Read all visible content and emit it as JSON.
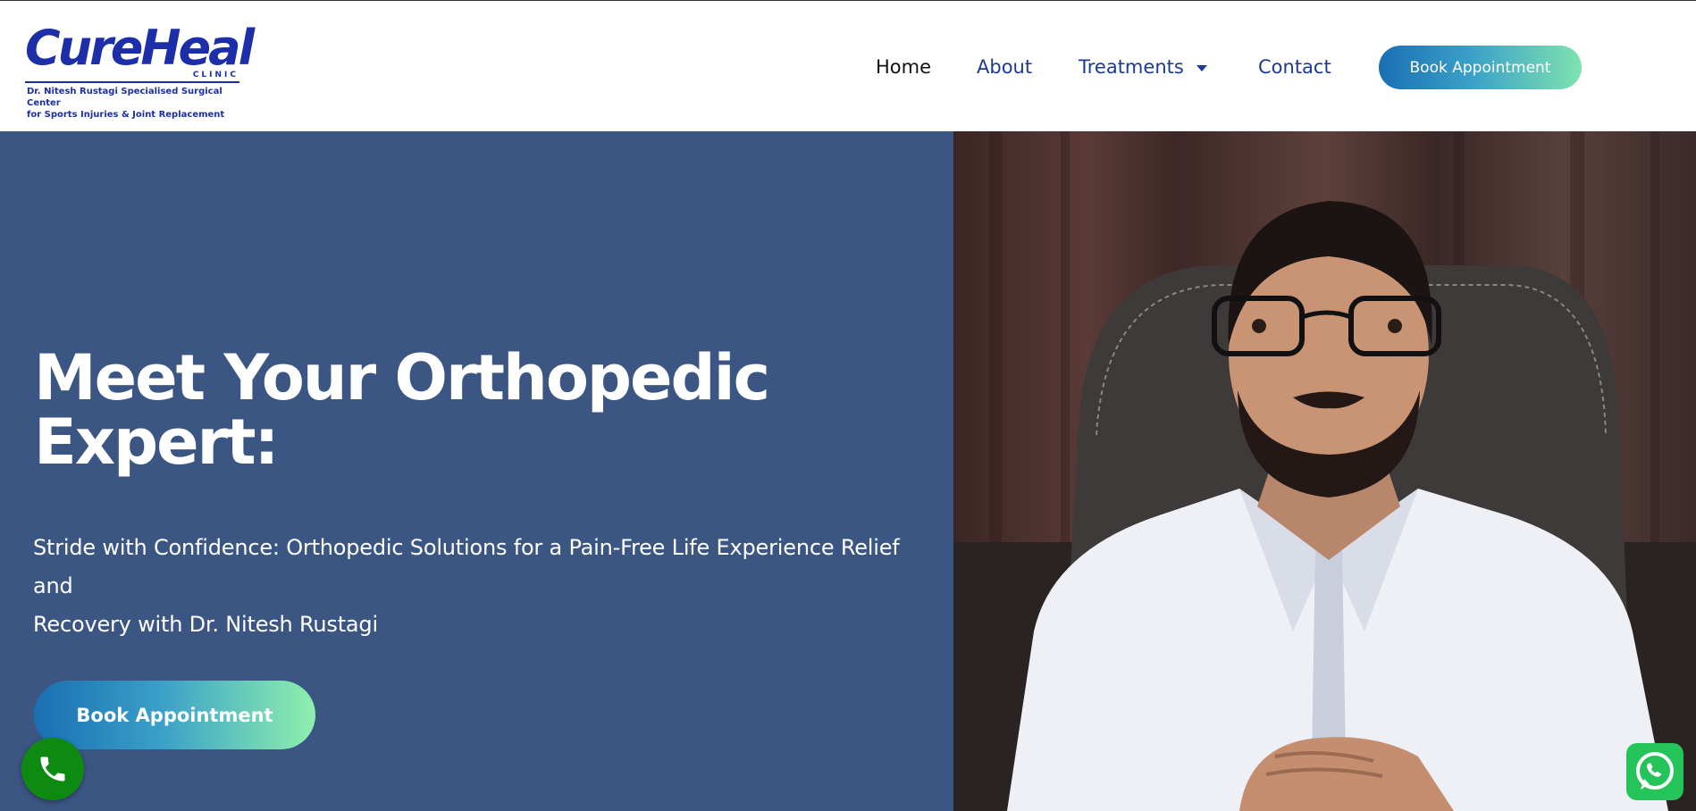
{
  "brand": {
    "name": "CureHeal",
    "sub": "CLINIC",
    "tagline_line1": "Dr. Nitesh Rustagi Specialised Surgical Center",
    "tagline_line2": "for Sports Injuries & Joint Replacement",
    "color": "#1c2fa8"
  },
  "nav": {
    "items": [
      {
        "label": "Home",
        "active": true
      },
      {
        "label": "About"
      },
      {
        "label": "Treatments",
        "has_dropdown": true
      },
      {
        "label": "Contact"
      }
    ],
    "cta_label": "Book Appointment"
  },
  "hero": {
    "title_line1": "Meet Your Orthopedic",
    "title_line2": "Expert:",
    "subtitle_line1": "Stride with Confidence: Orthopedic Solutions for a Pain-Free Life Experience Relief and",
    "subtitle_line2": "Recovery with Dr. Nitesh Rustagi",
    "cta_label": "Book Appointment",
    "background_color": "#3b5683"
  },
  "floating": {
    "call_icon": "phone-icon",
    "whatsapp_icon": "whatsapp-icon"
  }
}
